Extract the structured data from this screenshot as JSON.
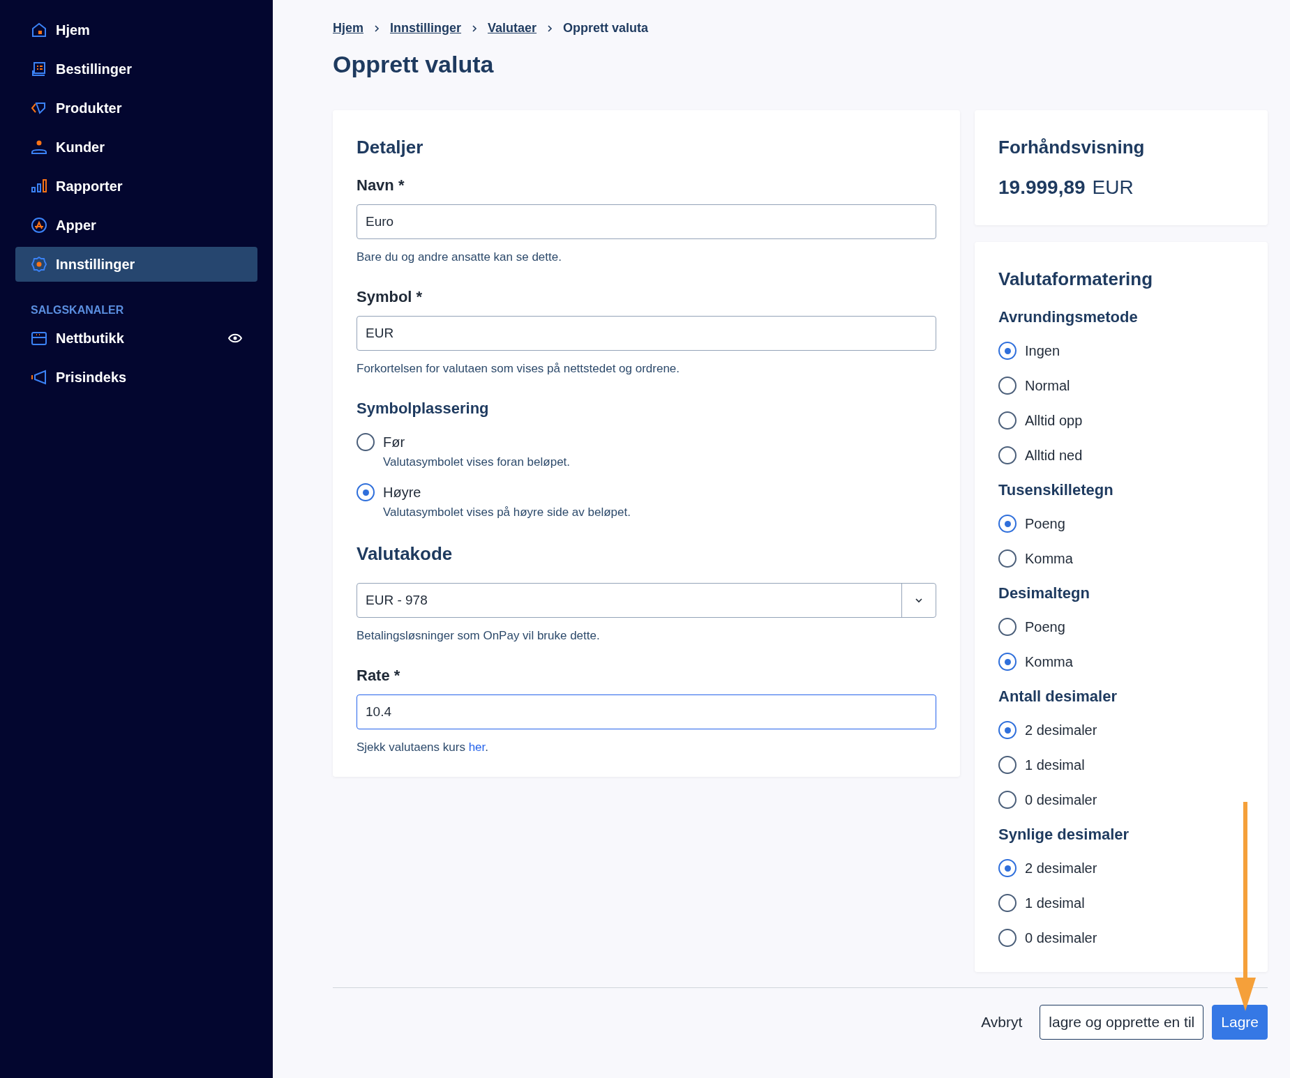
{
  "sidebar": {
    "items": [
      {
        "kind": "home",
        "label": "Hjem",
        "selected": false
      },
      {
        "kind": "orders",
        "label": "Bestillinger",
        "selected": false
      },
      {
        "kind": "tag",
        "label": "Produkter",
        "selected": false
      },
      {
        "kind": "user",
        "label": "Kunder",
        "selected": false
      },
      {
        "kind": "chart",
        "label": "Rapporter",
        "selected": false
      },
      {
        "kind": "apps",
        "label": "Apper",
        "selected": false
      },
      {
        "kind": "gear",
        "label": "Innstillinger",
        "selected": true
      }
    ],
    "section_title": "SALGSKANALER",
    "channels": [
      {
        "kind": "store",
        "label": "Nettbutikk",
        "visible": true
      },
      {
        "kind": "megaphone",
        "label": "Prisindeks",
        "visible": false
      }
    ]
  },
  "breadcrumb": [
    {
      "label": "Hjem",
      "current": false
    },
    {
      "label": "Innstillinger",
      "current": false
    },
    {
      "label": "Valutaer",
      "current": false
    },
    {
      "label": "Opprett valuta",
      "current": true
    }
  ],
  "page_title": "Opprett valuta",
  "details": {
    "title": "Detaljer",
    "name": {
      "label": "Navn *",
      "value": "Euro",
      "help": "Bare du og andre ansatte kan se dette.",
      "focused": false
    },
    "symbol": {
      "label": "Symbol *",
      "value": "EUR",
      "help": "Forkortelsen for valutaen som vises på nettstedet og ordrene.",
      "focused": false
    },
    "placement": {
      "title": "Symbolplassering",
      "options": [
        {
          "label": "Før",
          "description": "Valutasymbolet vises foran beløpet.",
          "selected": false
        },
        {
          "label": "Høyre",
          "description": "Valutasymbolet vises på høyre side av beløpet.",
          "selected": true
        }
      ]
    },
    "currency_code": {
      "title": "Valutakode",
      "value": "EUR - 978",
      "help": "Betalingsløsninger som OnPay vil bruke dette."
    },
    "rate": {
      "label": "Rate *",
      "value": "10.4",
      "focused": true,
      "help": "Sjekk valutaens kurs ",
      "help_link": "her",
      "help_end": "."
    }
  },
  "preview": {
    "title": "Forhåndsvisning",
    "amount": "19.999,89",
    "code": "EUR"
  },
  "formatting": {
    "title": "Valutaformatering",
    "groups": [
      {
        "title": "Avrundingsmetode",
        "options": [
          {
            "label": "Ingen",
            "selected": true
          },
          {
            "label": "Normal",
            "selected": false
          },
          {
            "label": "Alltid opp",
            "selected": false
          },
          {
            "label": "Alltid ned",
            "selected": false
          }
        ]
      },
      {
        "title": "Tusenskilletegn",
        "options": [
          {
            "label": "Poeng",
            "selected": true
          },
          {
            "label": "Komma",
            "selected": false
          }
        ]
      },
      {
        "title": "Desimaltegn",
        "options": [
          {
            "label": "Poeng",
            "selected": false
          },
          {
            "label": "Komma",
            "selected": true
          }
        ]
      },
      {
        "title": "Antall desimaler",
        "options": [
          {
            "label": "2 desimaler",
            "selected": true
          },
          {
            "label": "1 desimal",
            "selected": false
          },
          {
            "label": "0 desimaler",
            "selected": false
          }
        ]
      },
      {
        "title": "Synlige desimaler",
        "options": [
          {
            "label": "2 desimaler",
            "selected": true
          },
          {
            "label": "1 desimal",
            "selected": false
          },
          {
            "label": "0 desimaler",
            "selected": false
          }
        ]
      }
    ]
  },
  "footer_buttons": [
    {
      "label": "Avbryt",
      "kind": "text"
    },
    {
      "label": "lagre og opprette en til",
      "kind": "outline"
    },
    {
      "label": "Lagre",
      "kind": "primary"
    }
  ]
}
